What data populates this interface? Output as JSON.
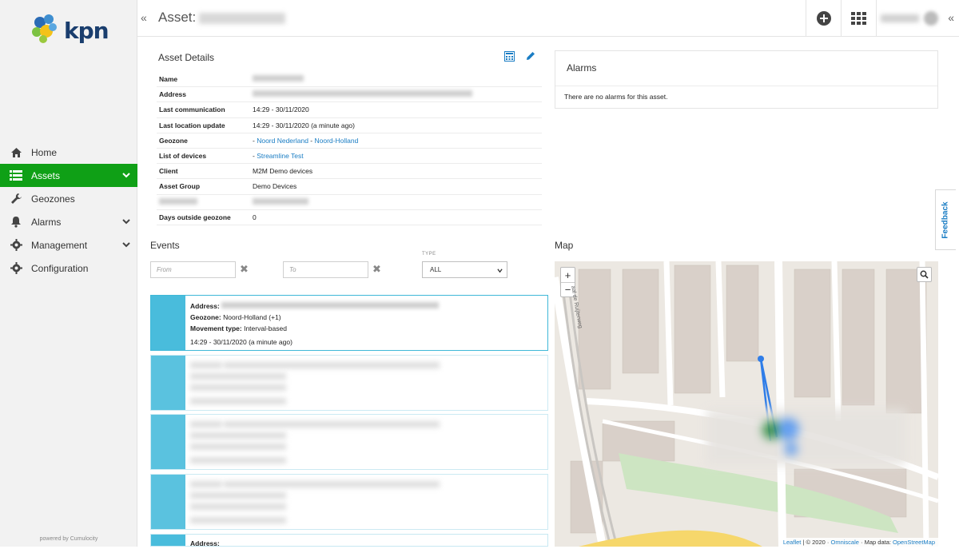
{
  "brand": {
    "name": "kpn",
    "powered_by": "powered by Cumulocity"
  },
  "sidebar": {
    "items": [
      {
        "label": "Home",
        "icon": "home-icon",
        "active": false,
        "expandable": false
      },
      {
        "label": "Assets",
        "icon": "list-icon",
        "active": true,
        "expandable": true
      },
      {
        "label": "Geozones",
        "icon": "wrench-icon",
        "active": false,
        "expandable": false
      },
      {
        "label": "Alarms",
        "icon": "bell-icon",
        "active": false,
        "expandable": true
      },
      {
        "label": "Management",
        "icon": "gear-icon",
        "active": false,
        "expandable": true
      },
      {
        "label": "Configuration",
        "icon": "gear-icon",
        "active": false,
        "expandable": false
      }
    ],
    "active_color": "#0fa016"
  },
  "header": {
    "title_prefix": "Asset:",
    "collapse_left": "«",
    "collapse_right": "«"
  },
  "asset_details": {
    "title": "Asset Details",
    "rows": [
      {
        "key": "Name",
        "value": ""
      },
      {
        "key": "Address",
        "value": ""
      },
      {
        "key": "Last communication",
        "value": "14:29 - 30/11/2020"
      },
      {
        "key": "Last location update",
        "value": "14:29 - 30/11/2020 (a minute ago)"
      },
      {
        "key": "Geozone",
        "value": ""
      },
      {
        "key": "List of devices",
        "value": ""
      },
      {
        "key": "Client",
        "value": "M2M Demo devices"
      },
      {
        "key": "Asset Group",
        "value": "Demo Devices"
      },
      {
        "key": "",
        "value": ""
      },
      {
        "key": "Days outside geozone",
        "value": "0"
      }
    ],
    "geozones": [
      "Noord Nederland",
      "Noord-Holland"
    ],
    "devices": [
      "Streamline Test"
    ]
  },
  "alarms": {
    "title": "Alarms",
    "empty_text": "There are no alarms for this asset."
  },
  "feedback_label": "Feedback",
  "events": {
    "title": "Events",
    "from_placeholder": "From",
    "to_placeholder": "To",
    "type_label": "TYPE",
    "type_value": "ALL",
    "first_event": {
      "address_label": "Address:",
      "geozone_label": "Geozone:",
      "geozone_value": "Noord-Holland (+1)",
      "movement_label": "Movement type:",
      "movement_value": "Interval-based",
      "time": "14:29 - 30/11/2020 (a minute ago)"
    },
    "last_partial_label": "Address:"
  },
  "map": {
    "title": "Map",
    "zoom_in": "+",
    "zoom_out": "−",
    "attribution_leaflet": "Leaflet",
    "attribution_mid": "| © 2020 ·",
    "attribution_omniscale": "Omniscale",
    "attribution_mapdata": "· Map data:",
    "attribution_osm": "OpenStreetMap",
    "street_label": "aal de Ruijterweg"
  },
  "colors": {
    "accent_blue": "#49bcdc",
    "link_blue": "#1a7dc4",
    "green": "#0fa016"
  }
}
